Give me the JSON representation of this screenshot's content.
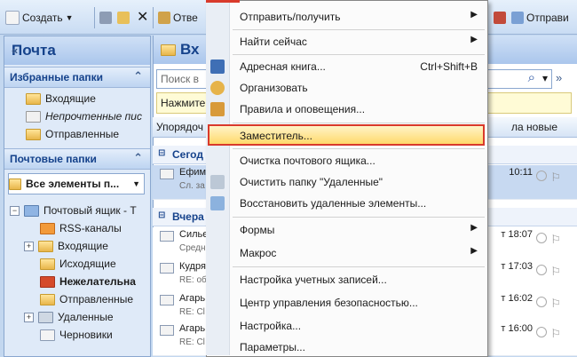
{
  "toolbar": {
    "create": "Создать",
    "reply_partial": "Отве",
    "send_receive_partial": "Отправи"
  },
  "nav": {
    "title": "Почта",
    "favorites_header": "Избранные папки",
    "favorites": [
      "Входящие",
      "Непрочтенные пис",
      "Отправленные"
    ],
    "mail_folders_header": "Почтовые папки",
    "all_items": "Все элементы п...",
    "mailbox": "Почтовый ящик - Т",
    "tree": [
      "RSS-каналы",
      "Входящие",
      "Исходящие",
      "Нежелательна",
      "Отправленные",
      "Удаленные",
      "Черновики"
    ]
  },
  "middle": {
    "title_partial": "Вх",
    "search_placeholder": "Поиск в",
    "hint_partial": "Нажмите",
    "arrange_partial": "Упорядоч",
    "arrange_right": "ла новые",
    "group_today": "Сегод",
    "group_yesterday": "Вчера",
    "messages": [
      {
        "from": "Ефим",
        "subject": "Сл. за",
        "date": "10:11",
        "selected": true
      },
      {
        "from": "Силье",
        "subject": "Средн",
        "date": "т 18:07"
      },
      {
        "from": "Кудря",
        "subject": "RE: об",
        "date": "т 17:03"
      },
      {
        "from": "Агарь",
        "subject": "RE: Cl",
        "date": "т 16:02"
      },
      {
        "from": "Агарь",
        "subject": "RE: Cl",
        "date": "т 16:00"
      }
    ]
  },
  "menu": {
    "items": [
      {
        "label": "Отправить/получить",
        "submenu": true
      },
      {
        "label": "Найти сейчас",
        "submenu": true
      },
      {
        "label": "Адресная книга...",
        "shortcut": "Ctrl+Shift+B"
      },
      {
        "label": "Организовать"
      },
      {
        "label": "Правила и оповещения..."
      },
      {
        "label": "Заместитель..."
      },
      {
        "label": "Очистка почтового ящика..."
      },
      {
        "label": "Очистить папку \"Удаленные\""
      },
      {
        "label": "Восстановить удаленные элементы..."
      },
      {
        "label": "Формы",
        "submenu": true
      },
      {
        "label": "Макрос",
        "submenu": true
      },
      {
        "label": "Настройка учетных записей..."
      },
      {
        "label": "Центр управления безопасностью..."
      },
      {
        "label": "Настройка..."
      },
      {
        "label": "Параметры..."
      }
    ]
  },
  "colors": {
    "highlight_border": "#d93a2b",
    "highlight_fill": "#ffd96b",
    "accent": "#15428b"
  },
  "glyphs": {
    "chevron_up": "«",
    "double_up": "⌃",
    "submenu_arrow": "▶",
    "search": "⌕",
    "dropdown": "▾",
    "flag": "⚐"
  }
}
